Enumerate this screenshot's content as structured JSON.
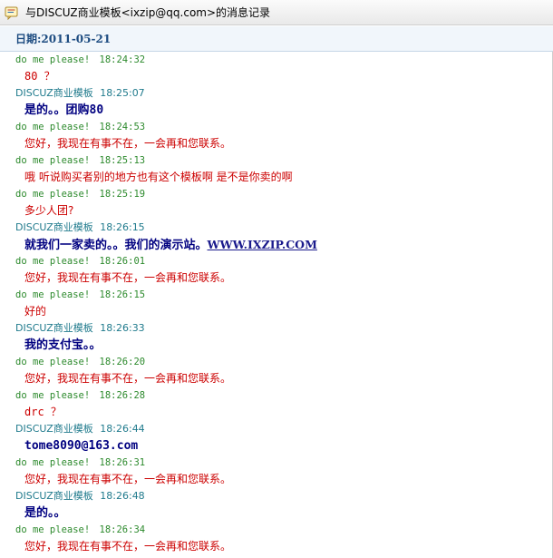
{
  "window": {
    "title": "与DISCUZ商业模板<ixzip@qq.com>的消息记录",
    "icon": "chat-log-icon"
  },
  "date_bar": {
    "label": "日期:2011-05-21"
  },
  "colors": {
    "away_header": "#2d8a2d",
    "discuz_header": "#1f7a8c",
    "reply_text": "#cc0000",
    "discuz_text": "#000080"
  },
  "messages": [
    {
      "sender": "do me please!",
      "time": "18:24:32",
      "text": "80 ？"
    },
    {
      "sender": "DISCUZ商业模板",
      "time": "18:25:07",
      "text": "是的。。团购80"
    },
    {
      "sender": "do me please!",
      "time": "18:24:53",
      "text": "您好，我现在有事不在，一会再和您联系。"
    },
    {
      "sender": "do me please!",
      "time": "18:25:13",
      "text": "哦 听说购买者别的地方也有这个模板啊 是不是你卖的啊"
    },
    {
      "sender": "do me please!",
      "time": "18:25:19",
      "text": "多少人团?"
    },
    {
      "sender": "DISCUZ商业模板",
      "time": "18:26:15",
      "text": "就我们一家卖的。。我们的演示站。",
      "link": "WWW.IXZIP.COM"
    },
    {
      "sender": "do me please!",
      "time": "18:26:01",
      "text": "您好，我现在有事不在，一会再和您联系。"
    },
    {
      "sender": "do me please!",
      "time": "18:26:15",
      "text": "好的"
    },
    {
      "sender": "DISCUZ商业模板",
      "time": "18:26:33",
      "text": "我的支付宝。。"
    },
    {
      "sender": "do me please!",
      "time": "18:26:20",
      "text": "您好，我现在有事不在，一会再和您联系。"
    },
    {
      "sender": "do me please!",
      "time": "18:26:28",
      "text": "drc ？"
    },
    {
      "sender": "DISCUZ商业模板",
      "time": "18:26:44",
      "text": "tome8090@163.com"
    },
    {
      "sender": "do me please!",
      "time": "18:26:31",
      "text": "您好，我现在有事不在，一会再和您联系。"
    },
    {
      "sender": "DISCUZ商业模板",
      "time": "18:26:48",
      "text": "是的。。"
    },
    {
      "sender": "do me please!",
      "time": "18:26:34",
      "text": "您好，我现在有事不在，一会再和您联系。"
    }
  ]
}
